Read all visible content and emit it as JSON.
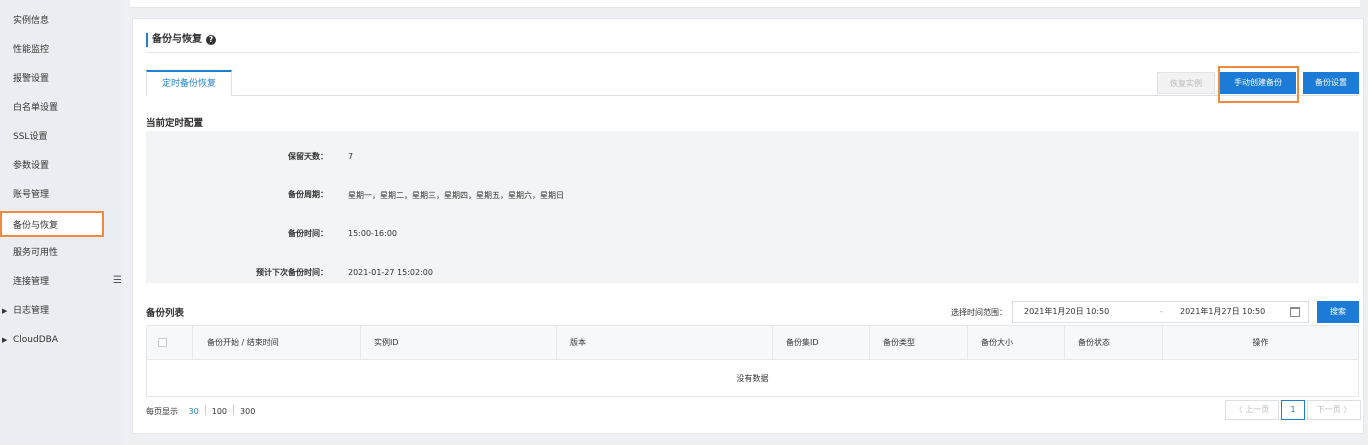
{
  "sidebar": {
    "items": [
      {
        "label": "实例信息"
      },
      {
        "label": "性能监控"
      },
      {
        "label": "报警设置"
      },
      {
        "label": "白名单设置"
      },
      {
        "label": "SSL设置"
      },
      {
        "label": "参数设置"
      },
      {
        "label": "账号管理"
      },
      {
        "label": "备份与恢复",
        "active": true
      },
      {
        "label": "服务可用性"
      },
      {
        "label": "连接管理"
      },
      {
        "label": "日志管理",
        "expandable": true
      },
      {
        "label": "CloudDBA",
        "expandable": true
      }
    ],
    "collapse_icon": "☰"
  },
  "page": {
    "title": "备份与恢复",
    "help_icon": "?"
  },
  "tabs": [
    {
      "label": "定时备份恢复"
    }
  ],
  "toolbar": {
    "restore_label": "恢复实例",
    "create_label": "手动创建备份",
    "settings_label": "备份设置"
  },
  "config": {
    "heading": "当前定时配置",
    "rows": [
      {
        "label": "保留天数：",
        "value": "7"
      },
      {
        "label": "备份周期：",
        "value": "星期一，星期二，星期三，星期四，星期五，星期六，星期日"
      },
      {
        "label": "备份时间：",
        "value": "15:00-16:00"
      },
      {
        "label": "预计下次备份时间：",
        "value": "2021-01-27 15:02:00"
      }
    ]
  },
  "backup_list": {
    "heading": "备份列表",
    "range_label": "选择时间范围：",
    "range_start": "2021年1月20日 10:50",
    "range_sep": "-",
    "range_end": "2021年1月27日 10:50",
    "search_label": "搜索",
    "columns": [
      "备份开始 / 结束时间",
      "实例ID",
      "版本",
      "备份集ID",
      "备份类型",
      "备份大小",
      "备份状态",
      "操作"
    ],
    "empty_text": "没有数据"
  },
  "pagination": {
    "per_page_label": "每页显示",
    "sizes": [
      "30",
      "100",
      "300"
    ],
    "prev_label": "〈 上一页",
    "current_page": "1",
    "next_label": "下一页 〉"
  },
  "colors": {
    "primary": "#1b7bd6",
    "highlight": "#f08a3e"
  }
}
